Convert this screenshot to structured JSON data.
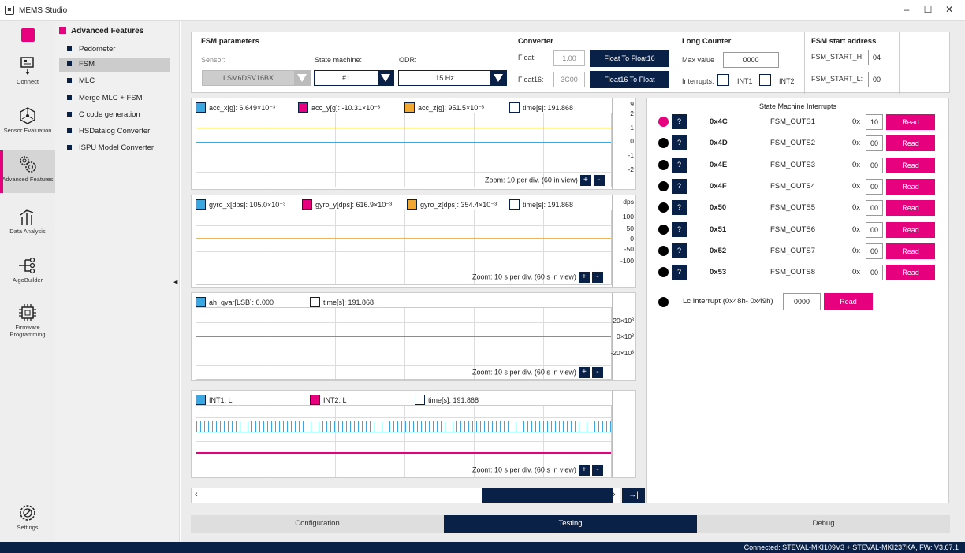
{
  "window": {
    "title": "MEMS Studio"
  },
  "nav": [
    {
      "label": "Connect",
      "icon": "connect-icon"
    },
    {
      "label": "Sensor Evaluation",
      "icon": "sensor-icon"
    },
    {
      "label": "Advanced Features",
      "icon": "gears-icon"
    },
    {
      "label": "Data Analysis",
      "icon": "chart-icon"
    },
    {
      "label": "AlgoBuilder",
      "icon": "algo-icon"
    },
    {
      "label": "Firmware Programming",
      "icon": "chip-icon"
    },
    {
      "label": "Settings",
      "icon": "settings-icon"
    }
  ],
  "submenu": {
    "title": "Advanced Features",
    "items": [
      "Pedometer",
      "FSM",
      "MLC",
      "Merge MLC + FSM",
      "C code generation",
      "HSDatalog Converter",
      "ISPU Model Converter"
    ]
  },
  "fsm": {
    "title": "FSM parameters",
    "sensor_label": "Sensor:",
    "sensor_value": "LSM6DSV16BX",
    "sm_label": "State machine:",
    "sm_value": "#1",
    "odr_label": "ODR:",
    "odr_value": "15 Hz"
  },
  "converter": {
    "title": "Converter",
    "float_label": "Float:",
    "float_value": "1.00",
    "float_btn": "Float To Float16",
    "float16_label": "Float16:",
    "float16_value": "3C00",
    "float16_btn": "Float16 To Float"
  },
  "long_counter": {
    "title": "Long Counter",
    "max_label": "Max value",
    "max_value": "0000",
    "interrupts_label": "Interrupts:",
    "int1": "INT1",
    "int2": "INT2"
  },
  "start_addr": {
    "title": "FSM start address",
    "h_label": "FSM_START_H:",
    "h_value": "04",
    "l_label": "FSM_START_L:",
    "l_value": "00"
  },
  "charts": {
    "acc": {
      "legend_x": "acc_x[g]: 6.649×10⁻³",
      "legend_y": "acc_y[g]: -10.31×10⁻³",
      "legend_z": "acc_z[g]: 951.5×10⁻³",
      "time": "time[s]: 191.868",
      "zoom": "Zoom: 10  per div. (60  in view)",
      "ticks": [
        "9",
        "2",
        "1",
        "0",
        "-1",
        "-2"
      ]
    },
    "gyro": {
      "legend_x": "gyro_x[dps]: 105.0×10⁻³",
      "legend_y": "gyro_y[dps]: 616.9×10⁻³",
      "legend_z": "gyro_z[dps]: 354.4×10⁻³",
      "time": "time[s]: 191.868",
      "zoom": "Zoom: 10 s per div. (60 s in view)",
      "ticks": [
        "dps",
        "100",
        "50",
        "0",
        "-50",
        "-100"
      ]
    },
    "qvar": {
      "legend_x": "ah_qvar[LSB]: 0.000",
      "time": "time[s]: 191.868",
      "zoom": "Zoom: 10 s per div. (60 s in view)",
      "ticks": [
        "20×10³",
        "0×10³",
        "-20×10³"
      ]
    },
    "int": {
      "legend_x": "INT1: L",
      "legend_y": "INT2: L",
      "time": "time[s]: 191.868",
      "zoom": "Zoom: 10 s per div. (60 s in view)"
    },
    "plus": "+",
    "minus": "-"
  },
  "state_machine": {
    "title": "State Machine Interrupts",
    "rows": [
      {
        "reg": "0x4C",
        "name": "FSM_OUTS1",
        "prefix": "0x",
        "value": "10",
        "read": "Read",
        "q": "?"
      },
      {
        "reg": "0x4D",
        "name": "FSM_OUTS2",
        "prefix": "0x",
        "value": "00",
        "read": "Read",
        "q": "?"
      },
      {
        "reg": "0x4E",
        "name": "FSM_OUTS3",
        "prefix": "0x",
        "value": "00",
        "read": "Read",
        "q": "?"
      },
      {
        "reg": "0x4F",
        "name": "FSM_OUTS4",
        "prefix": "0x",
        "value": "00",
        "read": "Read",
        "q": "?"
      },
      {
        "reg": "0x50",
        "name": "FSM_OUTS5",
        "prefix": "0x",
        "value": "00",
        "read": "Read",
        "q": "?"
      },
      {
        "reg": "0x51",
        "name": "FSM_OUTS6",
        "prefix": "0x",
        "value": "00",
        "read": "Read",
        "q": "?"
      },
      {
        "reg": "0x52",
        "name": "FSM_OUTS7",
        "prefix": "0x",
        "value": "00",
        "read": "Read",
        "q": "?"
      },
      {
        "reg": "0x53",
        "name": "FSM_OUTS8",
        "prefix": "0x",
        "value": "00",
        "read": "Read",
        "q": "?"
      }
    ],
    "lc_label": "Lc Interrupt (0x48h- 0x49h)",
    "lc_value": "0000",
    "lc_read": "Read"
  },
  "tabs": [
    "Configuration",
    "Testing",
    "Debug"
  ],
  "status": "Connected:  STEVAL-MKI109V3 + STEVAL-MKI237KA, FW: V3.67.1",
  "colors": {
    "navy": "#0a2147",
    "magenta": "#e6007e",
    "x_series": "#3aa8e0",
    "y_series": "#e6007e",
    "z_series": "#f0a830"
  }
}
